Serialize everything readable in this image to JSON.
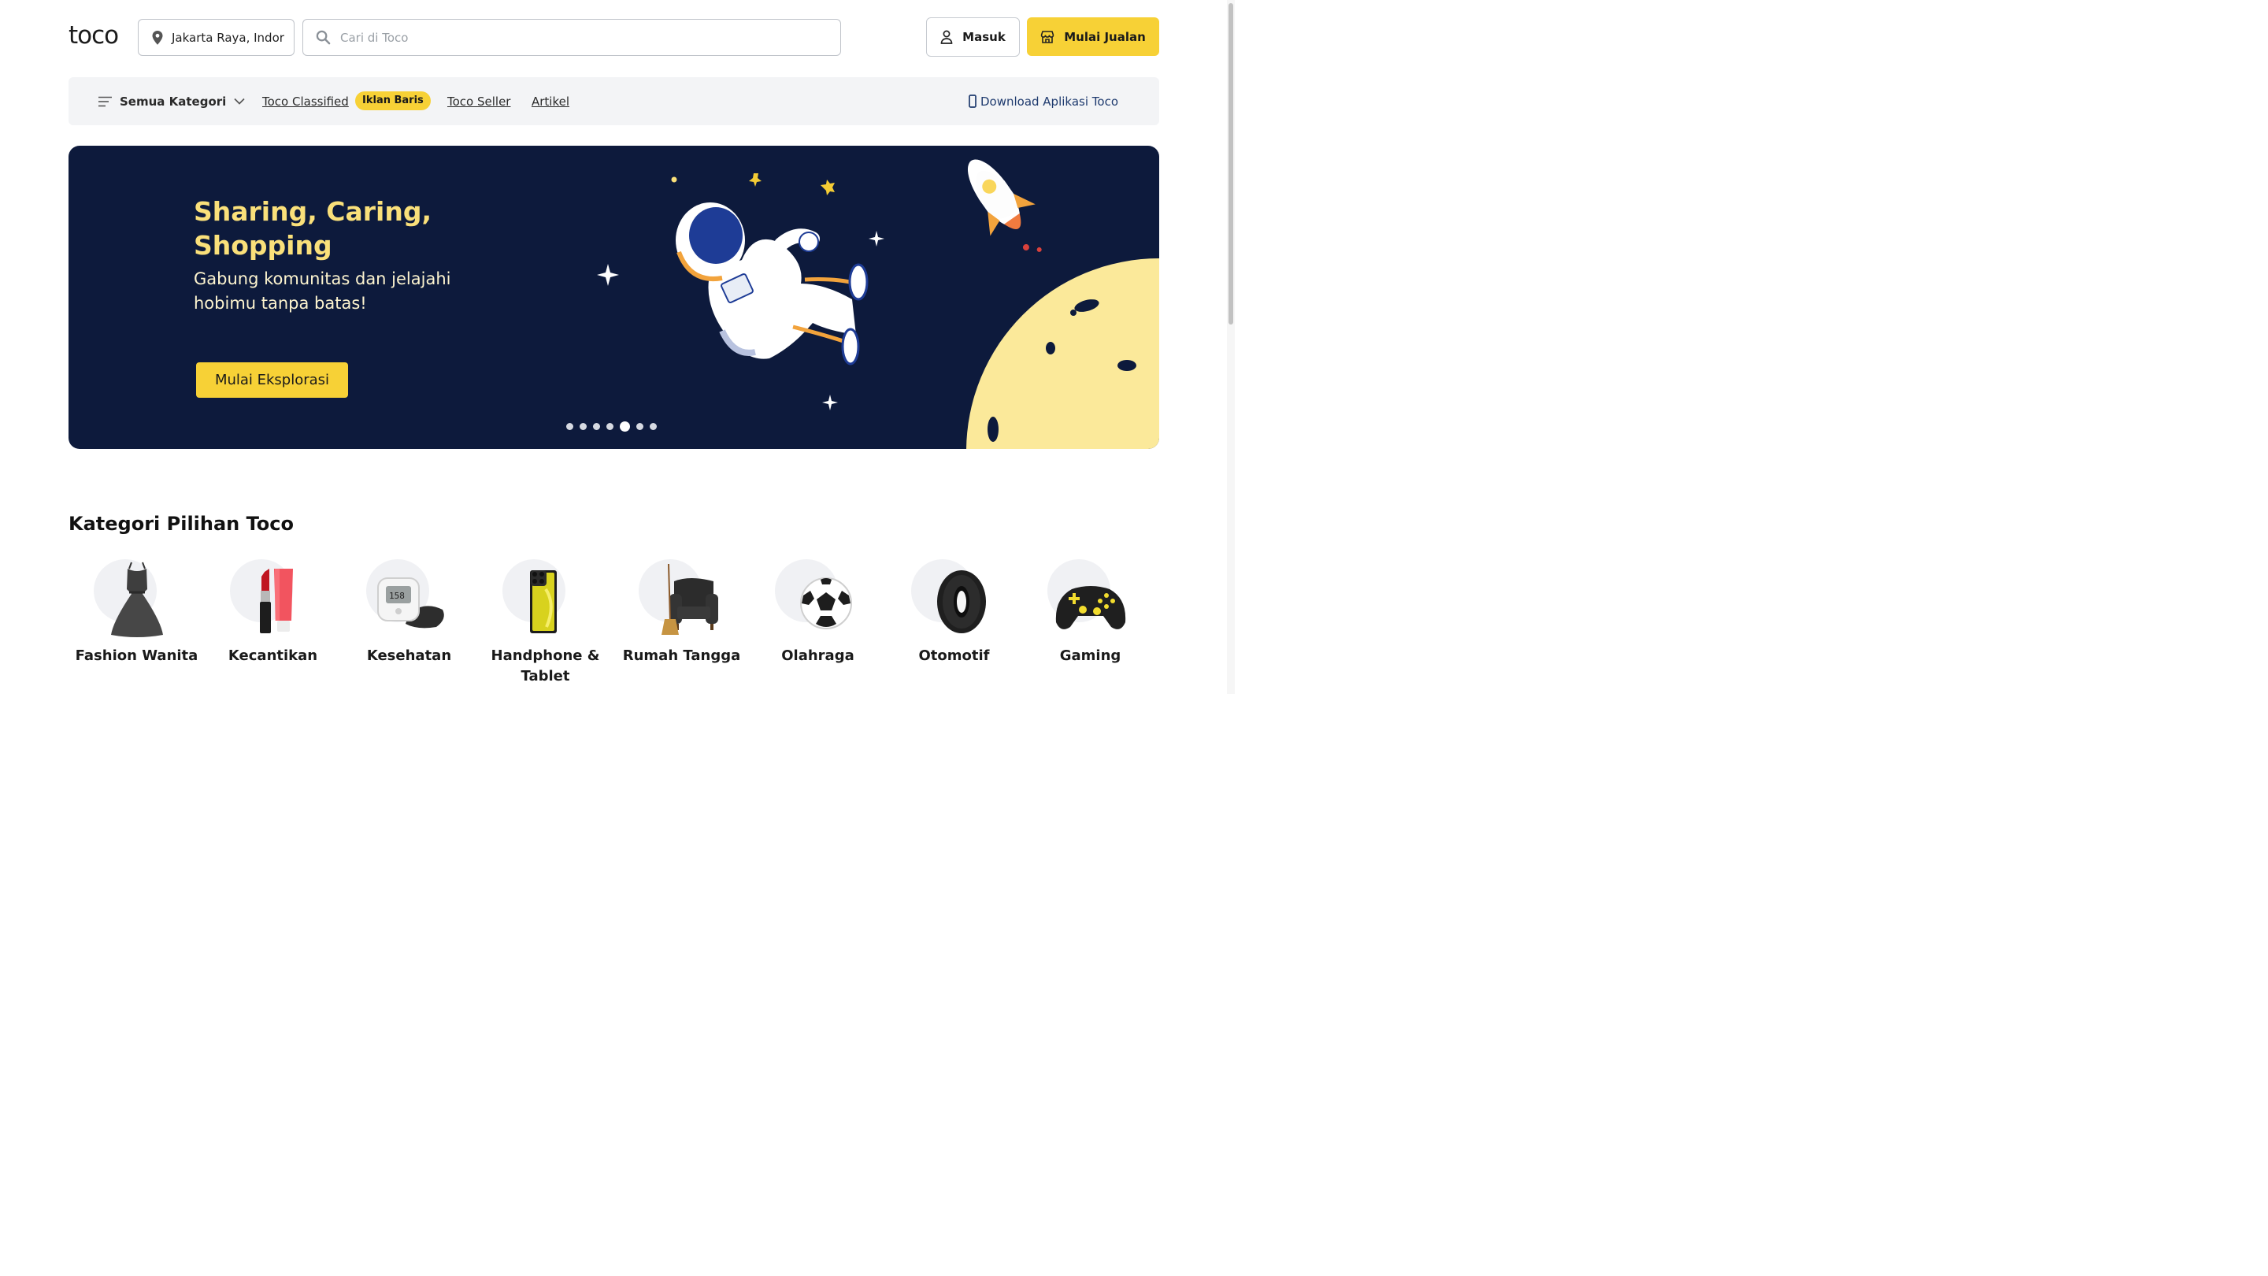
{
  "header": {
    "logo": "toco",
    "location": "Jakarta Raya, Indor",
    "search_placeholder": "Cari di Toco",
    "login_label": "Masuk",
    "sell_label": "Mulai Jualan"
  },
  "nav": {
    "all_categories": "Semua Kategori",
    "classified": "Toco Classified",
    "classified_badge": "Iklan Baris",
    "seller": "Toco Seller",
    "article": "Artikel",
    "download": "Download Aplikasi Toco"
  },
  "banner": {
    "title": "Sharing, Caring, Shopping",
    "subtitle": "Gabung komunitas dan jelajahi hobimu tanpa batas!",
    "cta": "Mulai Eksplorasi",
    "slide_count": 7,
    "active_slide": 5
  },
  "categories_section": {
    "title": "Kategori Pilihan Toco",
    "items": [
      {
        "label": "Fashion Wanita",
        "icon": "dress-icon"
      },
      {
        "label": "Kecantikan",
        "icon": "lipstick-icon"
      },
      {
        "label": "Kesehatan",
        "icon": "blood-pressure-monitor-icon"
      },
      {
        "label": "Handphone & Tablet",
        "icon": "smartphone-icon"
      },
      {
        "label": "Rumah Tangga",
        "icon": "armchair-icon"
      },
      {
        "label": "Olahraga",
        "icon": "soccer-ball-icon"
      },
      {
        "label": "Otomotif",
        "icon": "tire-icon"
      },
      {
        "label": "Gaming",
        "icon": "gamepad-icon"
      }
    ]
  },
  "colors": {
    "accent": "#f7d136",
    "banner_bg": "#0d1a3c",
    "banner_title": "#fae07a",
    "nav_bg": "#f3f4f6",
    "link_blue": "#1e3a6e"
  }
}
